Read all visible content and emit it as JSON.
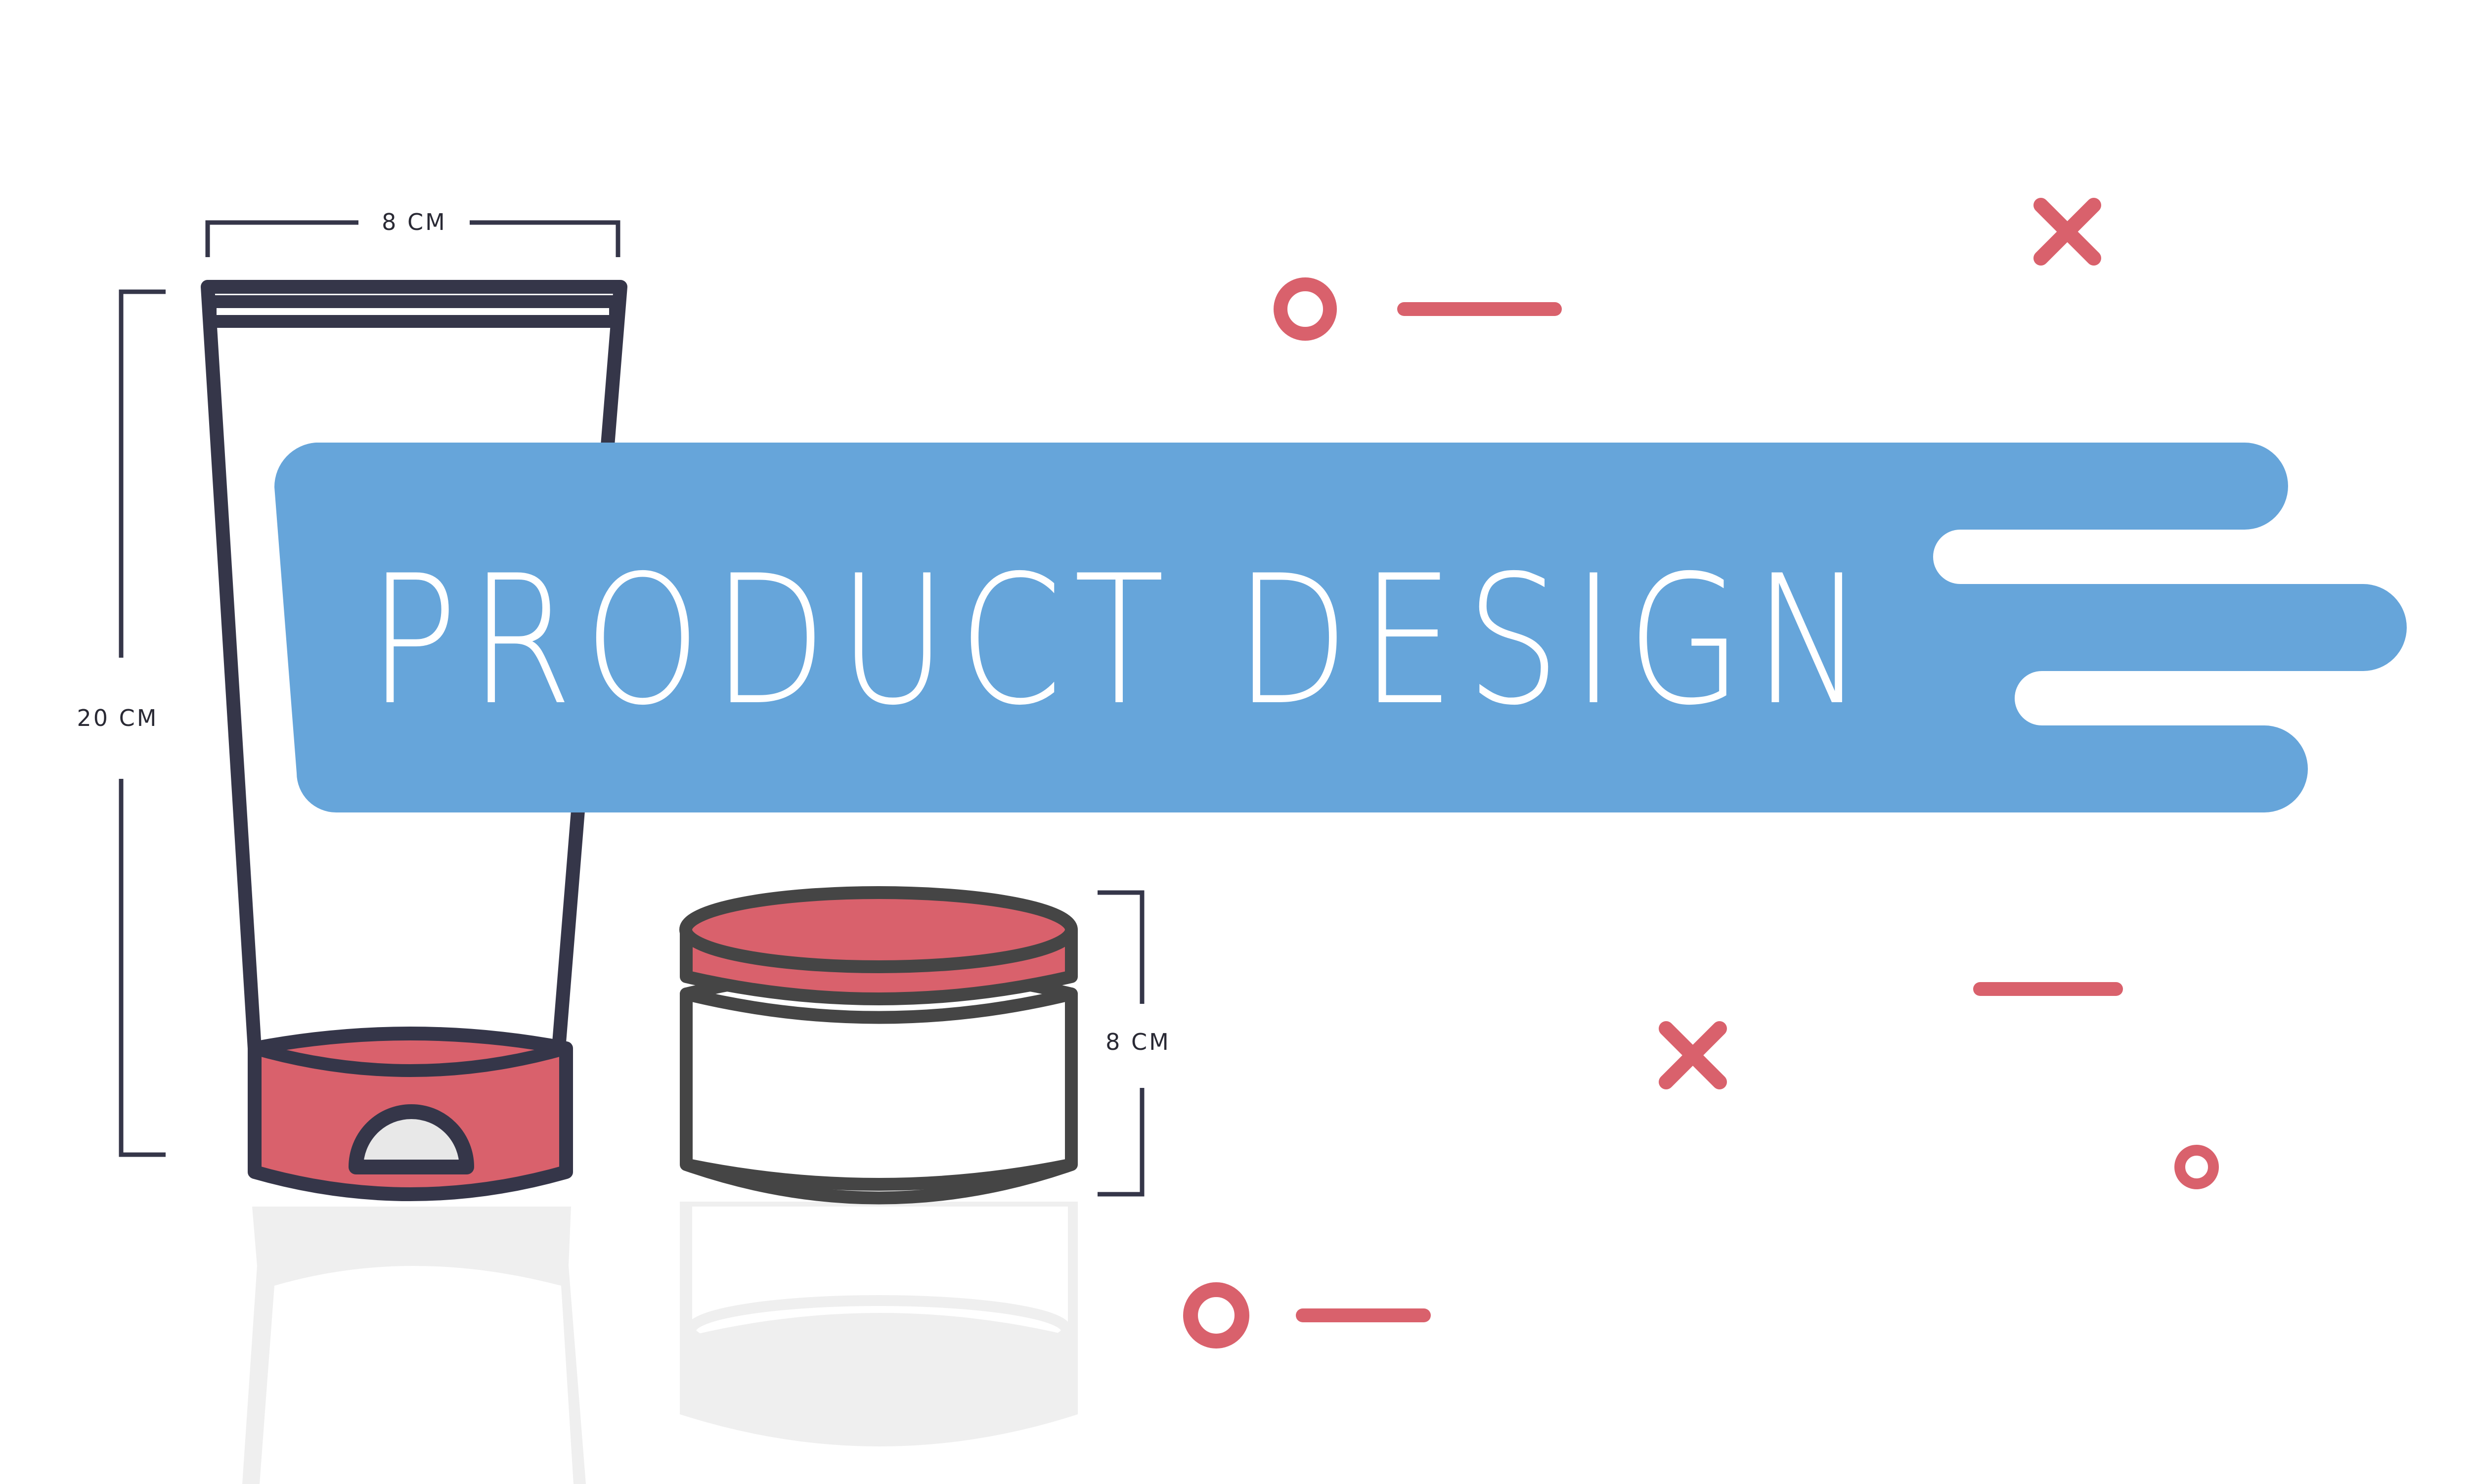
{
  "banner": {
    "title": "PRODUCT DESIGN"
  },
  "dimensions": {
    "tube_width": "8 CM",
    "tube_height": "20 CM",
    "jar_height": "8 CM"
  },
  "colors": {
    "banner": "#66a5da",
    "accent": "#d9616c",
    "outline": "#353649",
    "jar_outline": "#454545",
    "reflection": "#efefef",
    "background": "#ffffff"
  },
  "icons": [
    "circle-icon",
    "dash-icon",
    "x-mark-icon"
  ]
}
